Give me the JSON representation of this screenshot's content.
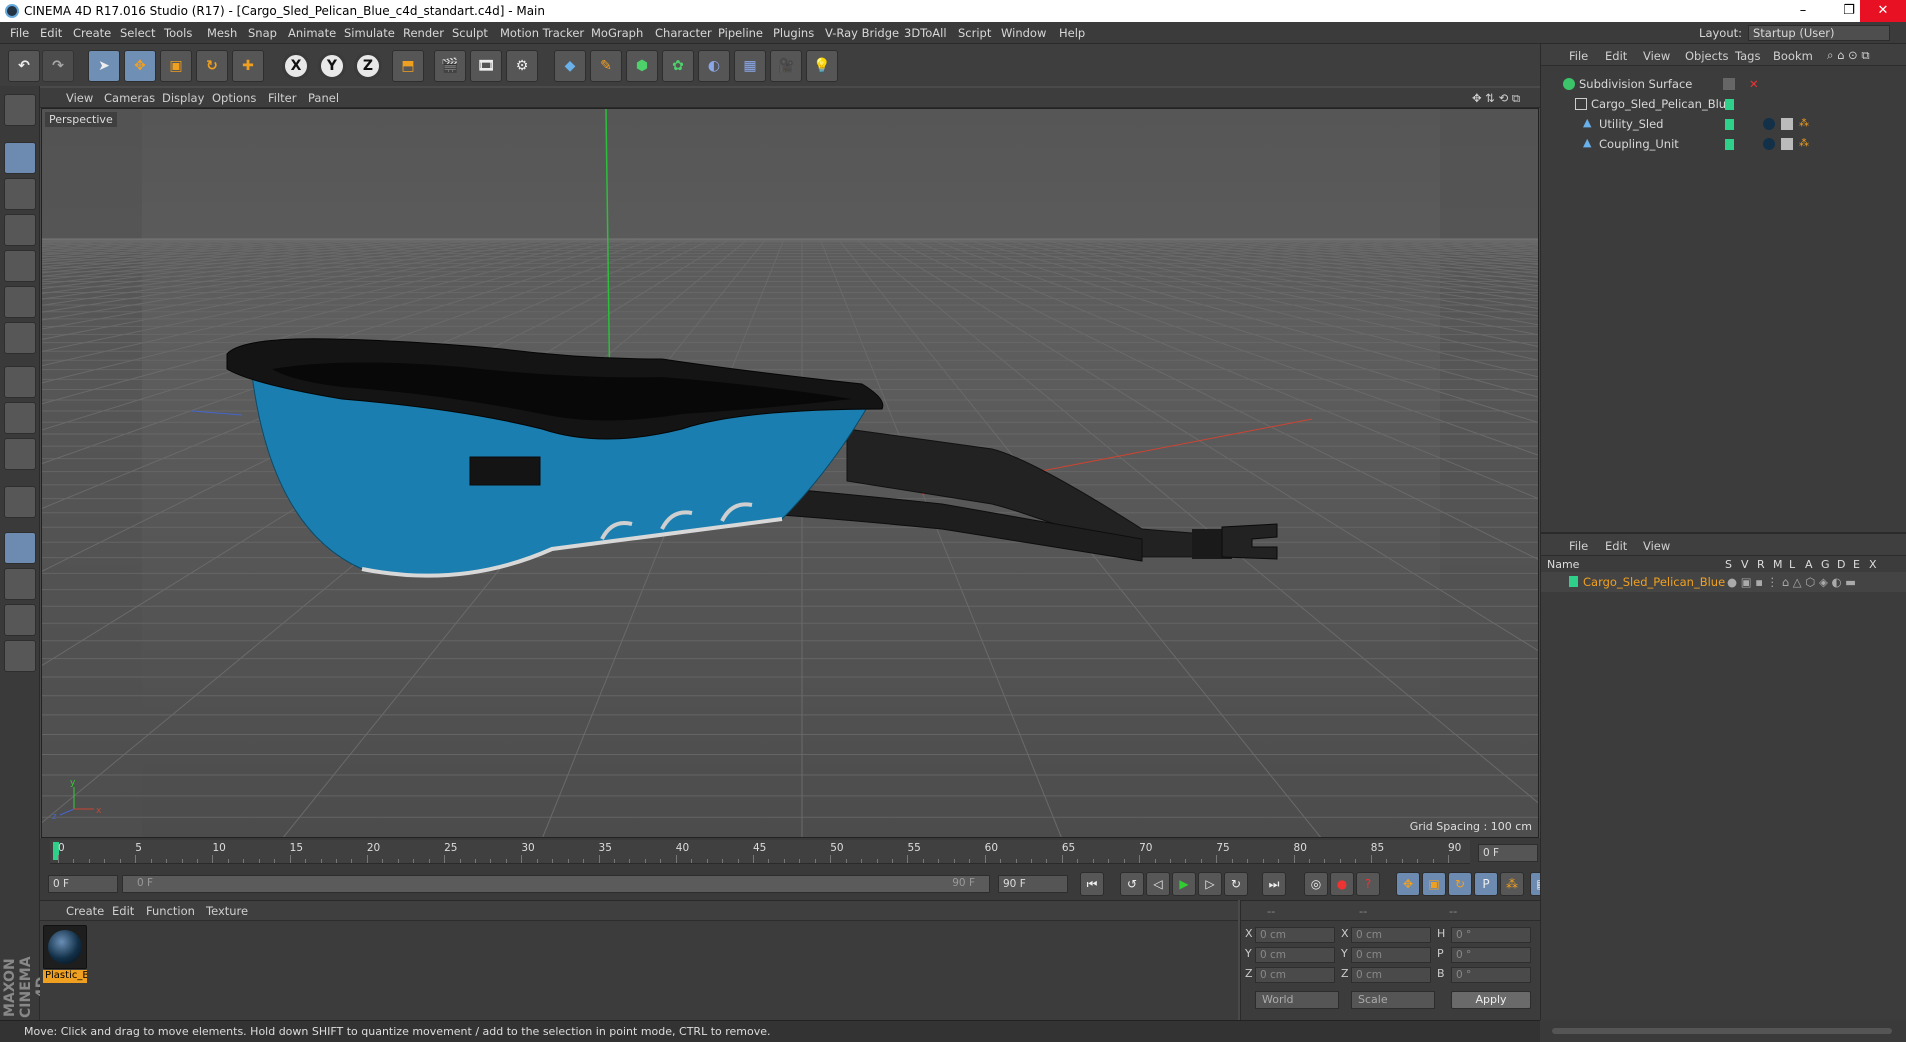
{
  "window": {
    "title": "CINEMA 4D R17.016 Studio (R17) - [Cargo_Sled_Pelican_Blue_c4d_standart.c4d] - Main",
    "minimize": "–",
    "restore": "❐",
    "close": "✕"
  },
  "menu": [
    "File",
    "Edit",
    "Create",
    "Select",
    "Tools",
    "Mesh",
    "Snap",
    "Animate",
    "Simulate",
    "Render",
    "Sculpt",
    "Motion Tracker",
    "MoGraph",
    "Character",
    "Pipeline",
    "Plugins",
    "V-Ray Bridge",
    "3DToAll",
    "Script",
    "Window",
    "Help"
  ],
  "layout": {
    "label": "Layout:",
    "value": "Startup (User)"
  },
  "toolbar": {
    "x": "X",
    "y": "Y",
    "z": "Z"
  },
  "viewport": {
    "menu": [
      "View",
      "Cameras",
      "Display",
      "Options",
      "Filter",
      "Panel"
    ],
    "label": "Perspective",
    "grid_spacing": "Grid Spacing : 100 cm"
  },
  "timeline": {
    "ticks": [
      "0",
      "5",
      "10",
      "15",
      "20",
      "25",
      "30",
      "35",
      "40",
      "45",
      "50",
      "55",
      "60",
      "65",
      "70",
      "75",
      "80",
      "85",
      "90"
    ],
    "current": "0 F",
    "start": "0 F",
    "range_start": "0 F",
    "range_end": "90 F",
    "end": "90 F"
  },
  "material_panel": {
    "menu": [
      "Create",
      "Edit",
      "Function",
      "Texture"
    ],
    "material_name": "Plastic_B"
  },
  "coords": {
    "header": [
      "--",
      "--",
      "--"
    ],
    "rows": [
      {
        "a": "X",
        "av": "0 cm",
        "b": "X",
        "bv": "0 cm",
        "c": "H",
        "cv": "0 °"
      },
      {
        "a": "Y",
        "av": "0 cm",
        "b": "Y",
        "bv": "0 cm",
        "c": "P",
        "cv": "0 °"
      },
      {
        "a": "Z",
        "av": "0 cm",
        "b": "Z",
        "bv": "0 cm",
        "c": "B",
        "cv": "0 °"
      }
    ],
    "world": "World",
    "scale": "Scale",
    "apply": "Apply"
  },
  "object_manager": {
    "menu": [
      "File",
      "Edit",
      "View",
      "Objects",
      "Tags",
      "Bookm"
    ],
    "items": [
      {
        "name": "Subdivision Surface",
        "indent": 0
      },
      {
        "name": "Cargo_Sled_Pelican_Blue",
        "indent": 1
      },
      {
        "name": "Utility_Sled",
        "indent": 2
      },
      {
        "name": "Coupling_Unit",
        "indent": 2
      }
    ]
  },
  "attribute_manager": {
    "menu": [
      "File",
      "Edit",
      "View"
    ],
    "columns": [
      "Name",
      "S",
      "V",
      "R",
      "M",
      "L",
      "A",
      "G",
      "D",
      "E",
      "X"
    ],
    "row_name": "Cargo_Sled_Pelican_Blue"
  },
  "status": "Move: Click and drag to move elements. Hold down SHIFT to quantize movement / add to the selection in point mode, CTRL to remove.",
  "colors": {
    "accent": "#f0a020",
    "sled_blue": "#1a7fb0",
    "layer_green": "#2fd18a"
  }
}
